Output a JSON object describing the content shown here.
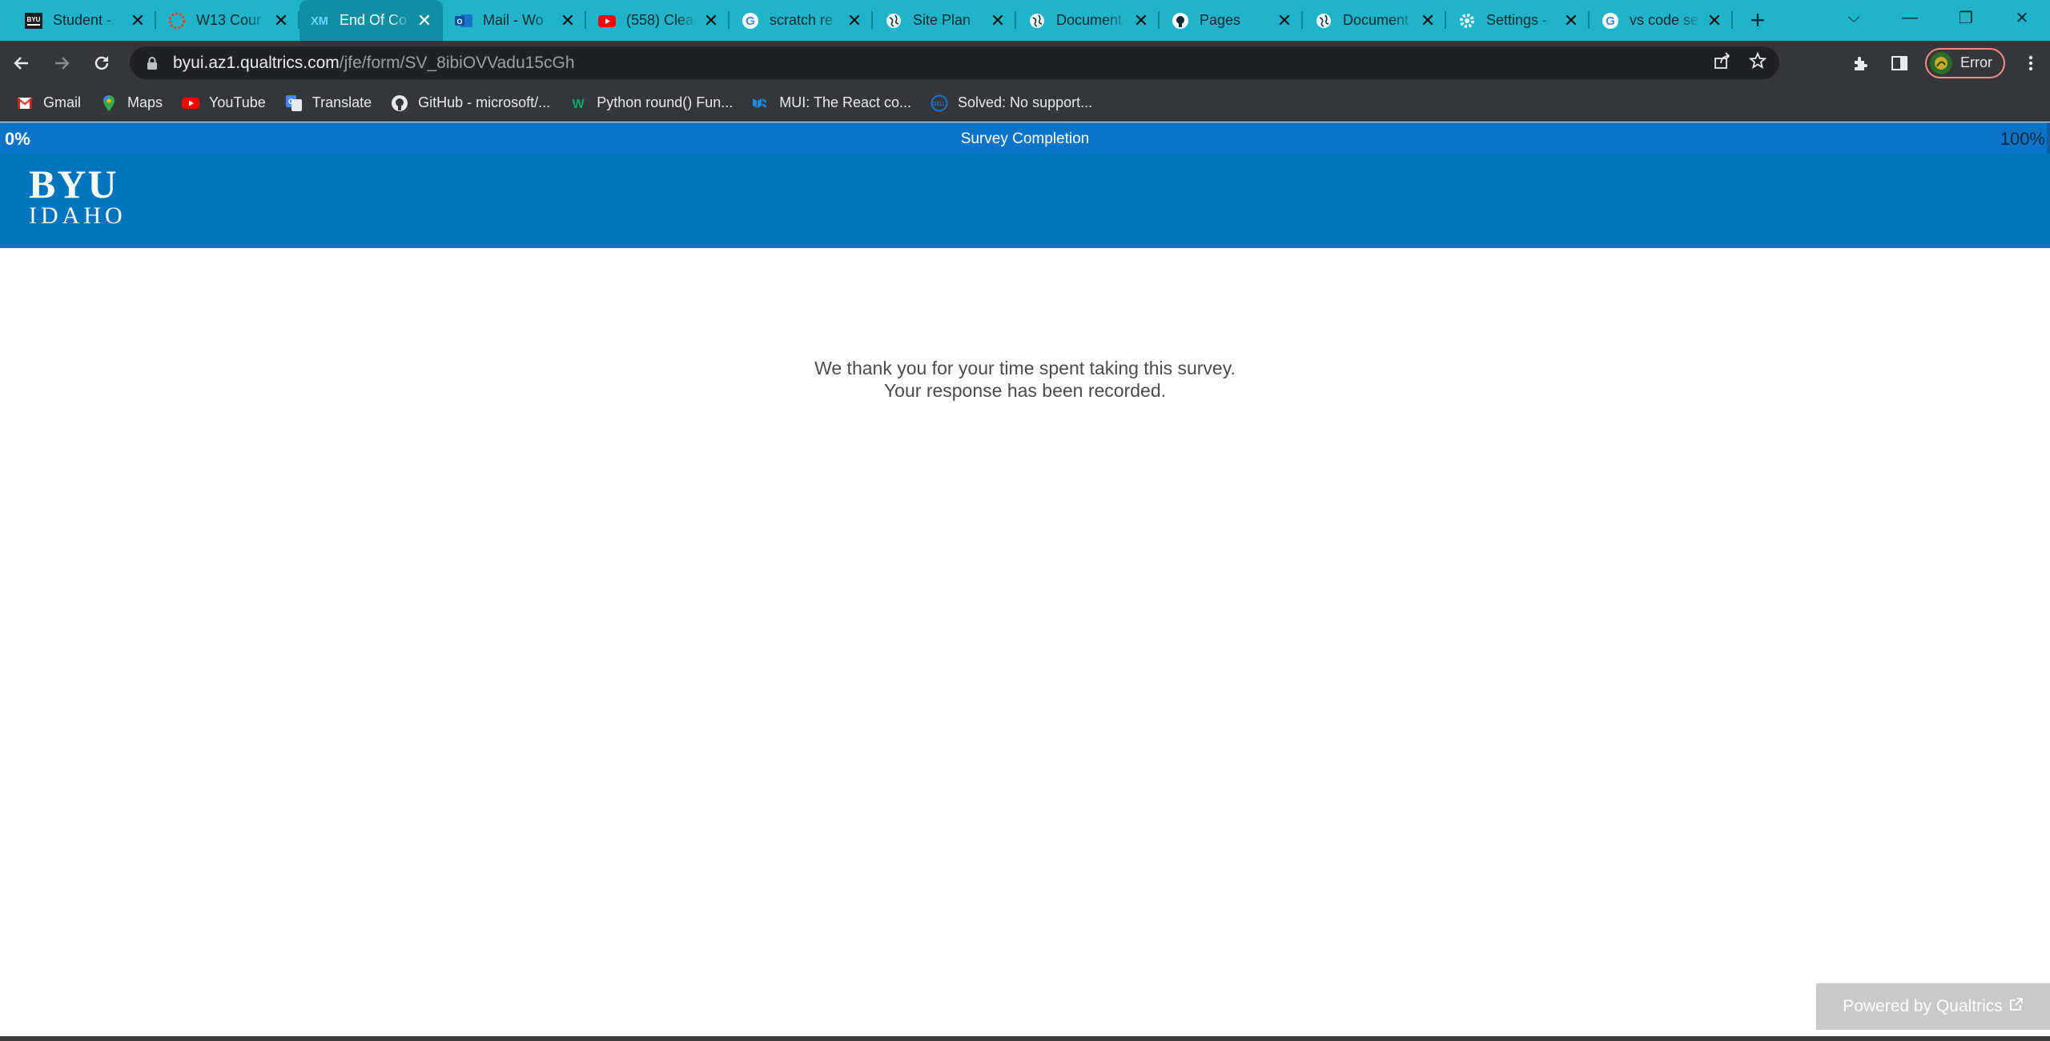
{
  "browser": {
    "tabs": [
      {
        "title": "Student - ",
        "icon": "byu-icon",
        "active": false
      },
      {
        "title": "W13 Cour",
        "icon": "canvas-icon",
        "active": false
      },
      {
        "title": "End Of Co",
        "icon": "qualtrics-xm-icon",
        "active": true
      },
      {
        "title": "Mail - Wo",
        "icon": "outlook-icon",
        "active": false
      },
      {
        "title": "(558) Clea",
        "icon": "youtube-icon",
        "active": false
      },
      {
        "title": "scratch re",
        "icon": "google-icon",
        "active": false
      },
      {
        "title": "Site Plan",
        "icon": "globe-icon",
        "active": false
      },
      {
        "title": "Document",
        "icon": "globe-icon",
        "active": false
      },
      {
        "title": "Pages",
        "icon": "github-icon",
        "active": false
      },
      {
        "title": "Document",
        "icon": "globe-icon",
        "active": false
      },
      {
        "title": "Settings - ",
        "icon": "gear-icon",
        "active": false
      },
      {
        "title": "vs code se",
        "icon": "google-icon",
        "active": false
      }
    ],
    "address": {
      "host": "byui.az1.qualtrics.com",
      "path": "/jfe/form/SV_8ibiOVVadu15cGh"
    },
    "profile_label": "Error",
    "bookmarks": [
      {
        "label": "Gmail",
        "icon": "gmail-icon"
      },
      {
        "label": "Maps",
        "icon": "maps-icon"
      },
      {
        "label": "YouTube",
        "icon": "youtube-icon"
      },
      {
        "label": "Translate",
        "icon": "translate-icon"
      },
      {
        "label": "GitHub - microsoft/...",
        "icon": "github-icon"
      },
      {
        "label": "Python round() Fun...",
        "icon": "w3schools-icon"
      },
      {
        "label": "MUI: The React co...",
        "icon": "mui-icon"
      },
      {
        "label": "Solved: No support...",
        "icon": "dell-icon"
      }
    ]
  },
  "survey": {
    "progress_start": "0%",
    "progress_label": "Survey Completion",
    "progress_end": "100%",
    "progress_fraction": 1.0,
    "logo_line1": "BYU",
    "logo_line2": "IDAHO",
    "message_line1": "We thank you for your time spent taking this survey.",
    "message_line2": "Your response has been recorded.",
    "powered_by": "Powered by Qualtrics"
  },
  "colors": {
    "tabstrip": "#1fb4c9",
    "active_tab": "#0f8fa4",
    "progress_bar": "#0c74c7",
    "banner": "#0074bd"
  }
}
